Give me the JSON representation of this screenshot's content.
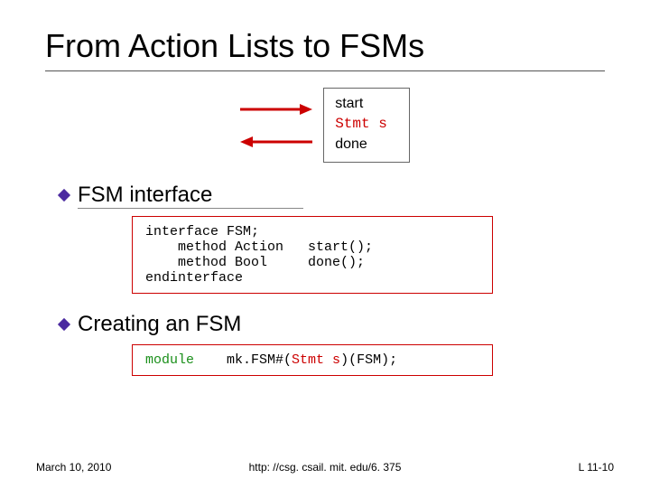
{
  "title": "From Action Lists to FSMs",
  "diagram": {
    "line1": "start",
    "line2": "Stmt s",
    "line3": "done"
  },
  "bullets": {
    "b1": "FSM interface",
    "b2": "Creating an FSM"
  },
  "code": {
    "interface": "interface FSM;\n    method Action   start();\n    method Bool     done();\nendinterface",
    "module_kw": "module",
    "module_call1": "    mk.FSM#(",
    "module_stmt": "Stmt s",
    "module_call2": ")(FSM);"
  },
  "footer": {
    "date": "March 10, 2010",
    "link": "http: //csg. csail. mit. edu/6. 375",
    "page": "L 11-10"
  }
}
